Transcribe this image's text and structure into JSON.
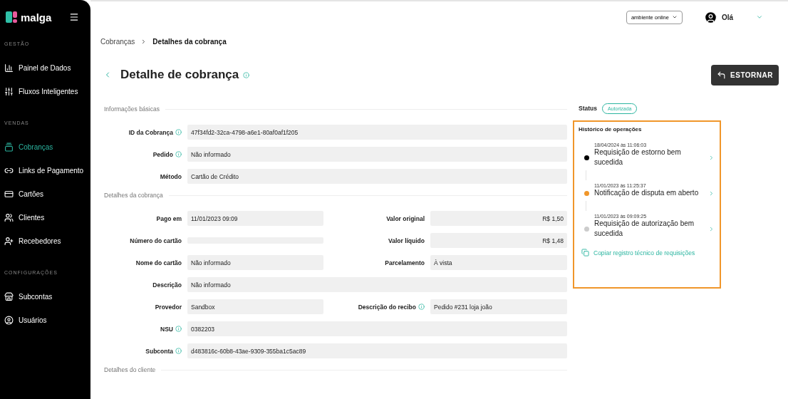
{
  "sidebar": {
    "logo": "malga",
    "groups": [
      {
        "title": "GESTÃO",
        "items": [
          {
            "label": "Painel de Dados",
            "selected": false
          },
          {
            "label": "Fluxos Inteligentes",
            "selected": false
          }
        ]
      },
      {
        "title": "VENDAS",
        "items": [
          {
            "label": "Cobranças",
            "selected": true
          },
          {
            "label": "Links de Pagamento",
            "selected": false
          },
          {
            "label": "Cartões",
            "selected": false
          },
          {
            "label": "Clientes",
            "selected": false
          },
          {
            "label": "Recebedores",
            "selected": false
          }
        ]
      },
      {
        "title": "CONFIGURAÇÕES",
        "items": [
          {
            "label": "Subcontas",
            "selected": false
          },
          {
            "label": "Usuários",
            "selected": false
          }
        ]
      }
    ]
  },
  "header": {
    "environment": "ambiente online",
    "greeting": "Olá"
  },
  "breadcrumb": [
    {
      "label": "Cobranças",
      "current": false
    },
    {
      "label": "Detalhes da cobrança",
      "current": true
    }
  ],
  "page_title": "Detalhe de cobrança",
  "action_button": "ESTORNAR",
  "sections": [
    {
      "title": "Informações básicas",
      "rows": [
        [
          {
            "label": "ID da Cobrança",
            "info": true,
            "value": "47f34fd2-32ca-4798-a6e1-80af0af1f205"
          }
        ],
        [
          {
            "label": "Pedido",
            "info": true,
            "value": "Não informado"
          }
        ],
        [
          {
            "label": "Método",
            "value": "Cartão de Crédito"
          }
        ]
      ]
    },
    {
      "title": "Detalhes da cobrança",
      "rows": [
        [
          {
            "label": "Pago em",
            "value": "11/01/2023 09:09"
          },
          {
            "label": "Valor original",
            "value": "R$ 1,50",
            "kind": "amount"
          }
        ],
        [
          {
            "label": "Número do cartão"
          },
          {
            "label": "Valor líquido",
            "value": "R$ 1,48",
            "kind": "amount"
          }
        ],
        [
          {
            "label": "Nome do cartão",
            "value": "Não informado"
          },
          {
            "label": "Parcelamento",
            "value": "À vista"
          }
        ],
        [
          {
            "label": "Descrição",
            "value": "Não informado"
          }
        ],
        [
          {
            "label": "Provedor",
            "value": "Sandbox"
          },
          {
            "label": "Descrição do recibo",
            "info": true,
            "value": "Pedido #231 loja joão"
          }
        ],
        [
          {
            "label": "NSU",
            "info": true,
            "value": "0382203"
          }
        ],
        [
          {
            "label": "Subconta",
            "info": true,
            "value": "d483816c-60b8-43ae-9309-355ba1c5ac89"
          }
        ]
      ]
    },
    {
      "title": "Detalhes do cliente"
    }
  ],
  "status": {
    "label": "Status",
    "value": "Autorizada"
  },
  "history": {
    "title": "Histórico de operações",
    "items": [
      {
        "date": "18/04/2024 às 11:06:03",
        "text": "Requisição de estorno bem sucedida",
        "color": "#000000"
      },
      {
        "date": "11/01/2023 às 11:25:37",
        "text": "Notificação de disputa em aberto",
        "color": "#f0962a"
      },
      {
        "date": "11/01/2023 às 09:09:25",
        "text": "Requisição de autorização bem sucedida",
        "color": "#cccccc"
      }
    ],
    "copy_link": "Copiar registro técnico de requisições"
  }
}
